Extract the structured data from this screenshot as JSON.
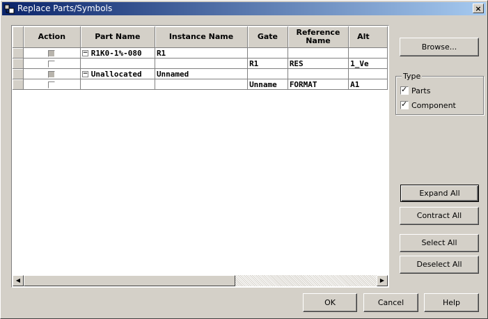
{
  "window": {
    "title": "Replace Parts/Symbols",
    "close_label": "×"
  },
  "grid": {
    "columns": [
      "Action",
      "Part Name",
      "Instance Name",
      "Gate",
      "Reference Name",
      "Alt"
    ],
    "rows": [
      {
        "part_name": "R1K0-1%-080",
        "instance_name": "R1",
        "gate": "",
        "reference": "",
        "alt": "",
        "tree": "−",
        "action_gray": true
      },
      {
        "part_name": "",
        "instance_name": "",
        "gate": "R1",
        "reference": "RES",
        "alt": "1_Ve",
        "tree": "",
        "action_gray": false
      },
      {
        "part_name": "Unallocated",
        "instance_name": "Unnamed",
        "gate": "",
        "reference": "",
        "alt": "",
        "tree": "−",
        "action_gray": true
      },
      {
        "part_name": "",
        "instance_name": "",
        "gate": "Unname",
        "reference": "FORMAT",
        "alt": "A1",
        "tree": "",
        "action_gray": false
      }
    ]
  },
  "buttons": {
    "browse": "Browse...",
    "expand_all": "Expand All",
    "contract_all": "Contract All",
    "select_all": "Select All",
    "deselect_all": "Deselect All",
    "ok": "OK",
    "cancel": "Cancel",
    "help": "Help"
  },
  "type_group": {
    "legend": "Type",
    "parts_label": "Parts",
    "parts_checked": true,
    "component_label": "Component",
    "component_checked": true
  },
  "icons": [
    "app-icon",
    "close-icon",
    "collapse-icon",
    "scroll-left-icon",
    "scroll-right-icon",
    "check-icon"
  ]
}
